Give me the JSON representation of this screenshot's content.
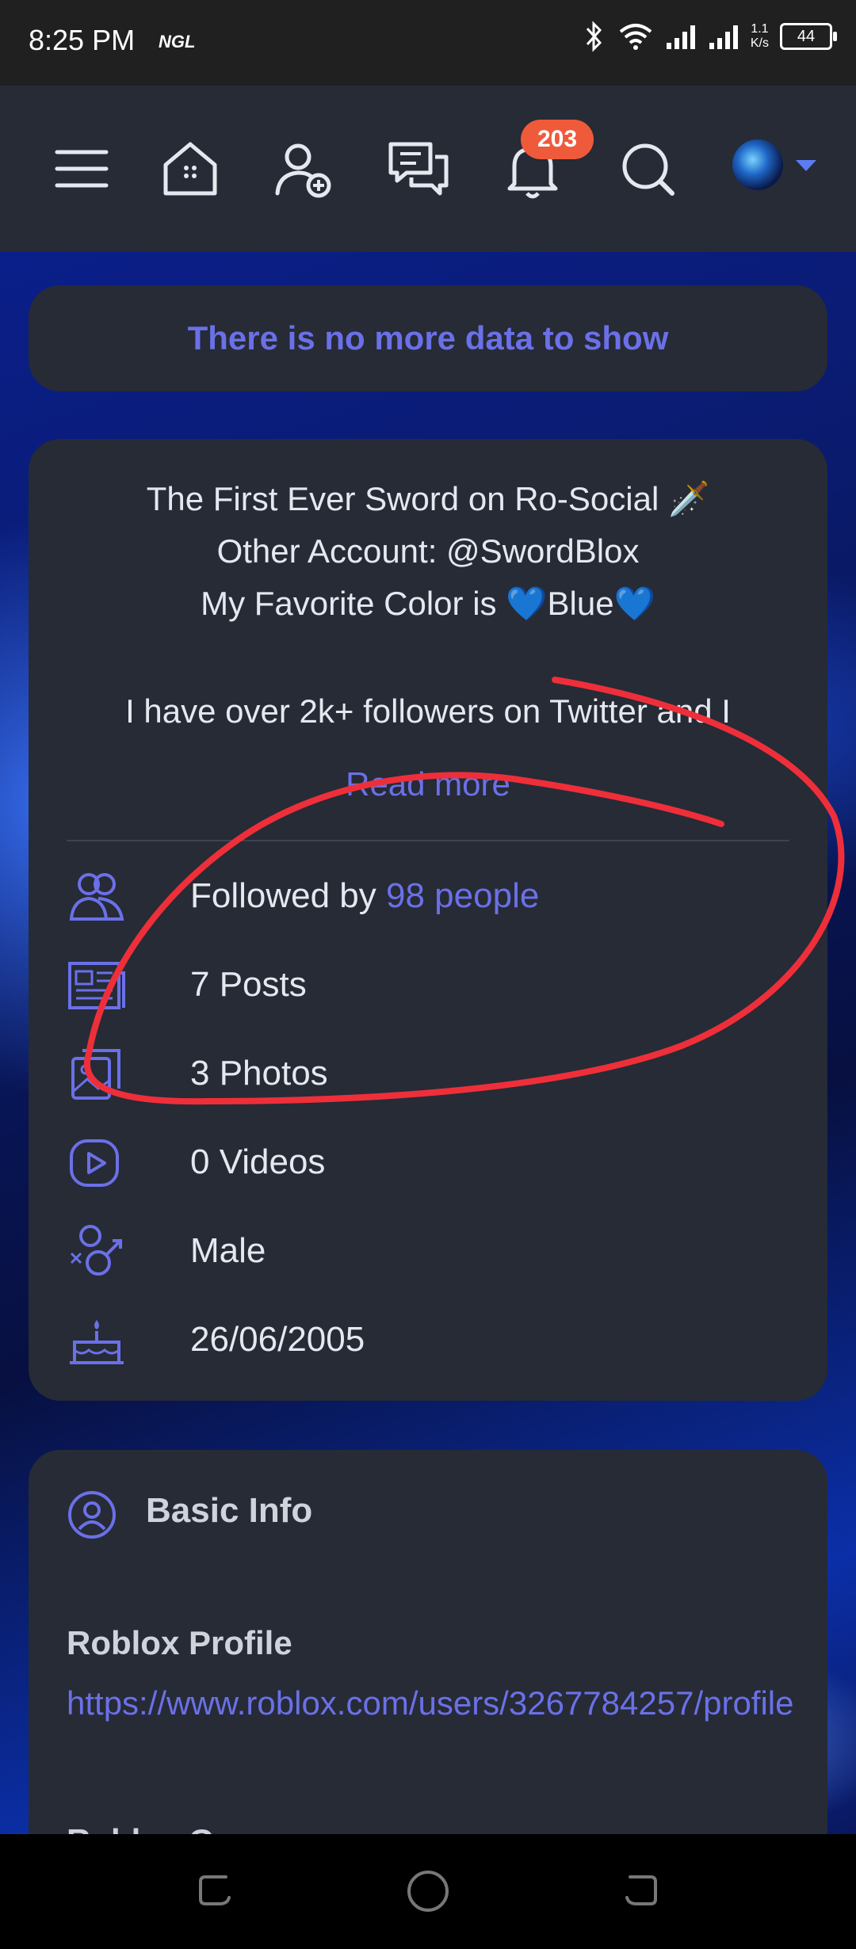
{
  "status_bar": {
    "time": "8:25 PM",
    "carrier_tag": "NGL",
    "net_speed_value": "1.1",
    "net_speed_unit": "K/s",
    "battery": "44"
  },
  "nav": {
    "notification_count": "203",
    "icons": [
      "menu-icon",
      "home-icon",
      "add-friend-icon",
      "messages-icon",
      "bell-icon",
      "search-icon",
      "avatar"
    ]
  },
  "banner": {
    "text": "There is no more data to show"
  },
  "about": {
    "bio_lines": [
      "The First Ever Sword on Ro-Social 🗡️",
      "Other Account: @SwordBlox",
      "My Favorite Color is 💙Blue💙",
      "I have over 2k+ followers on Twitter and I"
    ],
    "read_more": "Read more",
    "followed_prefix": "Followed by ",
    "followed_link": "98 people",
    "posts": "7 Posts",
    "photos": "3 Photos",
    "videos": "0 Videos",
    "gender": "Male",
    "birthday": "26/06/2005"
  },
  "basic_info": {
    "title": "Basic Info",
    "field_label": "Roblox Profile",
    "field_value": "https://www.roblox.com/users/3267784257/profile",
    "next_label": "Roblox G..."
  },
  "colors": {
    "accent": "#6b70e8",
    "card": "#262b36",
    "badge": "#ef5a3a",
    "annotation": "#ee2f3a"
  }
}
